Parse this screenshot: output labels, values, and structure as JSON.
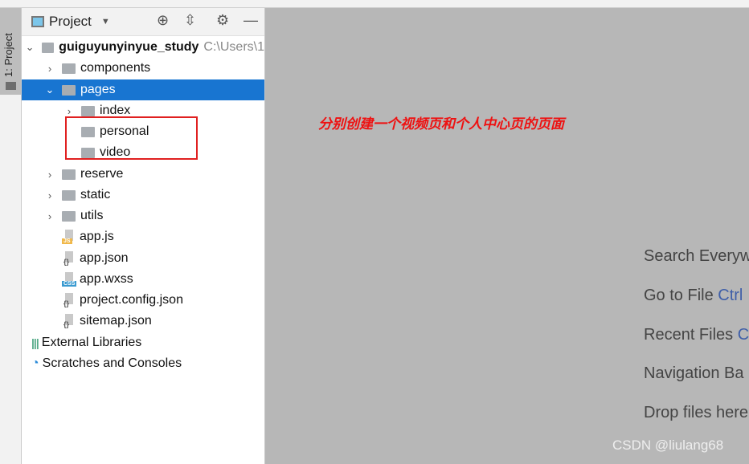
{
  "sidebar_stripe": {
    "label": "1: Project"
  },
  "panel": {
    "title": "Project",
    "tree": [
      {
        "label": "guiguyunyinyue_study",
        "path": "C:\\Users\\1",
        "type": "folder",
        "expanded": true,
        "level": 0
      },
      {
        "label": "components",
        "type": "folder",
        "level": 1
      },
      {
        "label": "pages",
        "type": "folder",
        "expanded": true,
        "selected": true,
        "level": 1
      },
      {
        "label": "index",
        "type": "folder",
        "level": 2
      },
      {
        "label": "personal",
        "type": "folder",
        "level": 2
      },
      {
        "label": "video",
        "type": "folder",
        "level": 2
      },
      {
        "label": "reserve",
        "type": "folder",
        "level": 1
      },
      {
        "label": "static",
        "type": "folder",
        "level": 1
      },
      {
        "label": "utils",
        "type": "folder",
        "level": 1
      },
      {
        "label": "app.js",
        "type": "js",
        "level": 1
      },
      {
        "label": "app.json",
        "type": "json",
        "level": 1
      },
      {
        "label": "app.wxss",
        "type": "css",
        "level": 1
      },
      {
        "label": "project.config.json",
        "type": "json",
        "level": 1
      },
      {
        "label": "sitemap.json",
        "type": "json",
        "level": 1
      },
      {
        "label": "External Libraries",
        "type": "libraries",
        "level": 0
      },
      {
        "label": "Scratches and Consoles",
        "type": "scratches",
        "level": 0
      }
    ]
  },
  "editor": {
    "annotation": "分别创建一个视频页和个人中心页的页面",
    "hints": [
      {
        "text": "Search Everyw",
        "key": ""
      },
      {
        "text": "Go to File ",
        "key": "Ctrl"
      },
      {
        "text": "Recent Files ",
        "key": "C"
      },
      {
        "text": "Navigation Ba",
        "key": ""
      },
      {
        "text": "Drop files here",
        "key": ""
      }
    ],
    "watermark": "CSDN @liulang68"
  },
  "colors": {
    "selection": "#1875d1",
    "annotation": "#ee1111",
    "editor_bg": "#b7b7b7"
  }
}
